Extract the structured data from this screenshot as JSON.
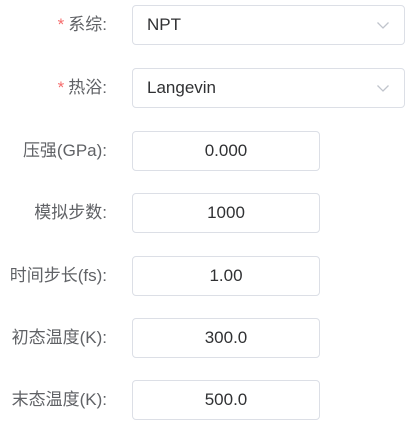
{
  "form": {
    "system": {
      "label": "系综:",
      "required_mark": "*",
      "value": "NPT"
    },
    "thermostat": {
      "label": "热浴:",
      "required_mark": "*",
      "value": "Langevin"
    },
    "pressure": {
      "label": "压强(GPa):",
      "value": "0.000"
    },
    "steps": {
      "label": "模拟步数:",
      "value": "1000"
    },
    "timestep": {
      "label": "时间步长(fs):",
      "value": "1.00"
    },
    "init_temp": {
      "label": "初态温度(K):",
      "value": "300.0"
    },
    "final_temp": {
      "label": "末态温度(K):",
      "value": "500.0"
    }
  },
  "icons": {
    "dropdown": "chevron-down-icon"
  },
  "colors": {
    "required": "#f56c6c",
    "label": "#606266",
    "border": "#dcdfe6",
    "text": "#303133"
  }
}
